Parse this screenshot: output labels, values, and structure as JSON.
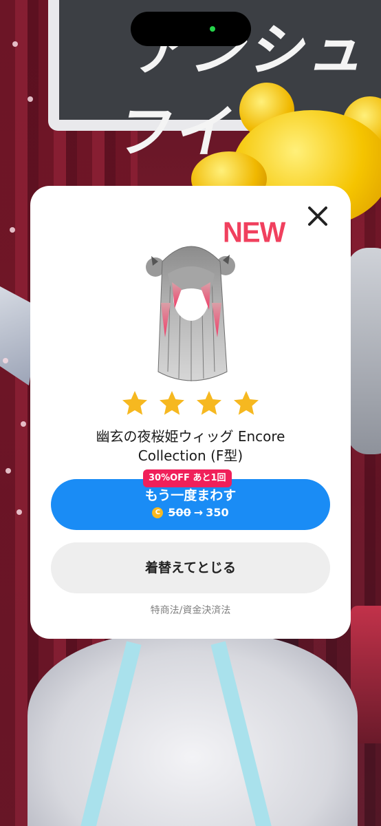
{
  "dialog": {
    "new_label": "NEW",
    "star_count": 4,
    "item_name_line1": "幽玄の夜桜姫ウィッグ Encore",
    "item_name_line2": "Collection (F型)",
    "discount_badge": "30%OFF あと1回",
    "spin_button_label": "もう一度まわす",
    "coin_icon_glyph": "C",
    "price_old": "500",
    "price_arrow": "→",
    "price_new": "350",
    "close_dress_button_label": "着替えてとじる",
    "legal_link": "特商法/資金決済法"
  },
  "colors": {
    "primary_button": "#1a8cf5",
    "discount_badge": "#f0205a",
    "new_badge": "#f0405e",
    "star": "#f6b820",
    "coin": "#f8b920"
  },
  "icons": {
    "close": "close-icon",
    "star": "star-icon",
    "coin": "coin-icon"
  }
}
